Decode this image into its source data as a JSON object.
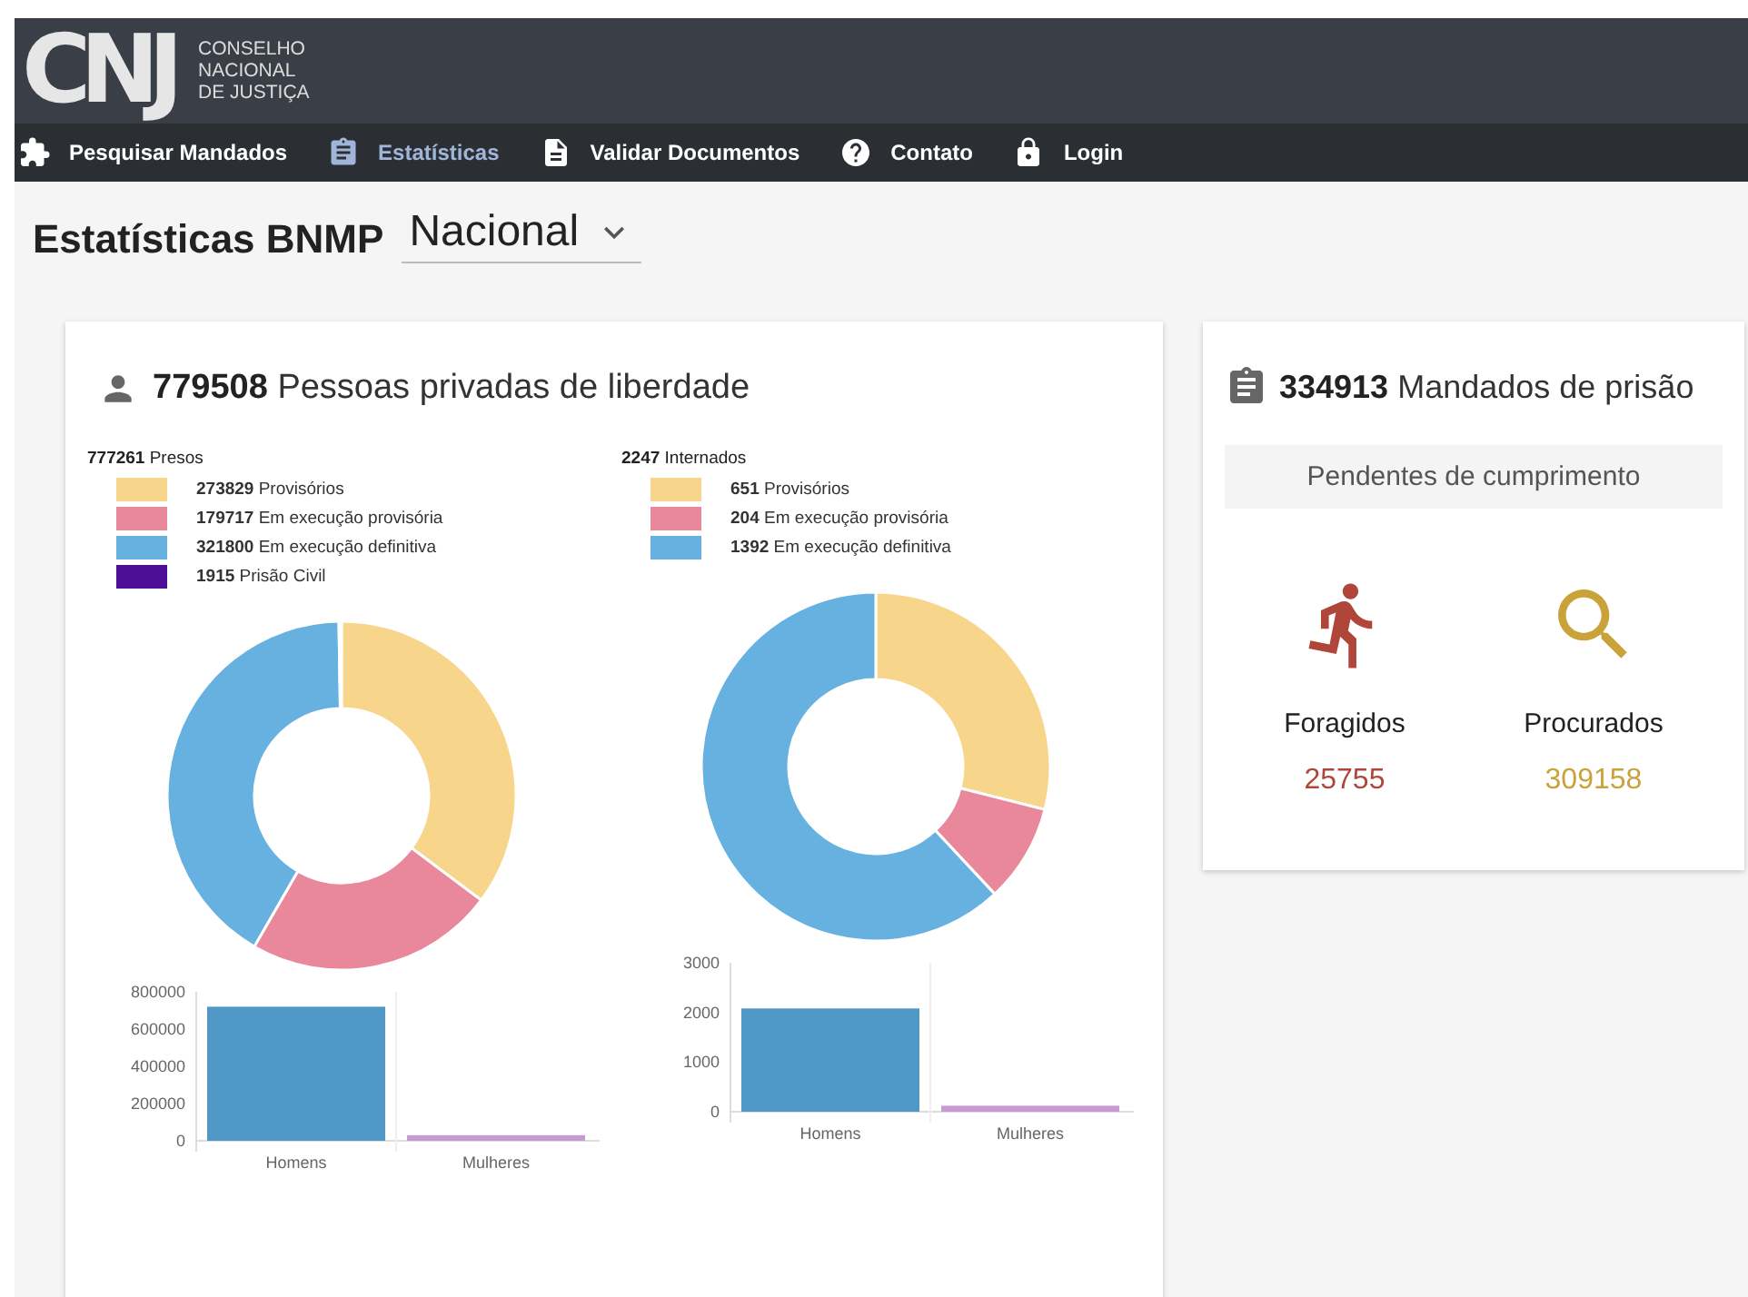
{
  "header": {
    "logo_mark": "CNJ",
    "logo_lines": [
      "CONSELHO",
      "NACIONAL",
      "DE JUSTIÇA"
    ]
  },
  "nav": [
    {
      "label": "Pesquisar Mandados",
      "selected": false
    },
    {
      "label": "Estatísticas",
      "selected": true
    },
    {
      "label": "Validar Documentos",
      "selected": false
    },
    {
      "label": "Contato",
      "selected": false
    },
    {
      "label": "Login",
      "selected": false
    }
  ],
  "page_title": "Estatísticas BNMP",
  "region_select": {
    "value": "Nacional"
  },
  "people_card": {
    "total": "779508",
    "title": "Pessoas privadas de liberdade",
    "groups": [
      {
        "heading": "**777261** Presos",
        "legend": [
          {
            "text": "**273829** Provisórios",
            "color": "#f7d58a"
          },
          {
            "text": "**179717** Em execução provisória",
            "color": "#e8889a"
          },
          {
            "text": "**321800** Em execução definitiva",
            "color": "#67b1e0"
          },
          {
            "text": "**1915** Prisão Civil",
            "color": "#4b0e94"
          }
        ],
        "donut": {
          "chart_data": {
            "type": "donut",
            "values": [
              35.23,
              23.12,
              41.4,
              0.25
            ]
          }
        },
        "bars": {
          "chart_data": {
            "type": "bar",
            "categories": [
              "Homens",
              "Mulheres"
            ],
            "values": [
              720000,
              30000
            ],
            "ylim": [
              0,
              800000
            ],
            "yticks": [
              0,
              200000,
              400000,
              600000,
              800000
            ]
          }
        }
      },
      {
        "heading": "**2247** Internados",
        "legend": [
          {
            "text": "**651** Provisórios",
            "color": "#f7d58a"
          },
          {
            "text": "**204** Em execução provisória",
            "color": "#e8889a"
          },
          {
            "text": "**1392** Em execução definitiva",
            "color": "#67b1e0"
          }
        ],
        "donut": {
          "chart_data": {
            "type": "donut",
            "values": [
              28.97,
              9.08,
              61.95
            ]
          }
        },
        "bars": {
          "chart_data": {
            "type": "bar",
            "categories": [
              "Homens",
              "Mulheres"
            ],
            "values": [
              2080,
              120
            ],
            "ylim": [
              0,
              3000
            ],
            "yticks": [
              0,
              1000,
              2000,
              3000
            ]
          }
        }
      }
    ]
  },
  "warrants_card": {
    "total": "334913",
    "title": "Mandados de prisão",
    "subtitle": "Pendentes de cumprimento",
    "stats": [
      {
        "kind": "fugitive",
        "label": "Foragidos",
        "value": "25755",
        "color": "#b0463a"
      },
      {
        "kind": "wanted",
        "label": "Procurados",
        "value": "309158",
        "color": "#c9a33a"
      }
    ]
  }
}
